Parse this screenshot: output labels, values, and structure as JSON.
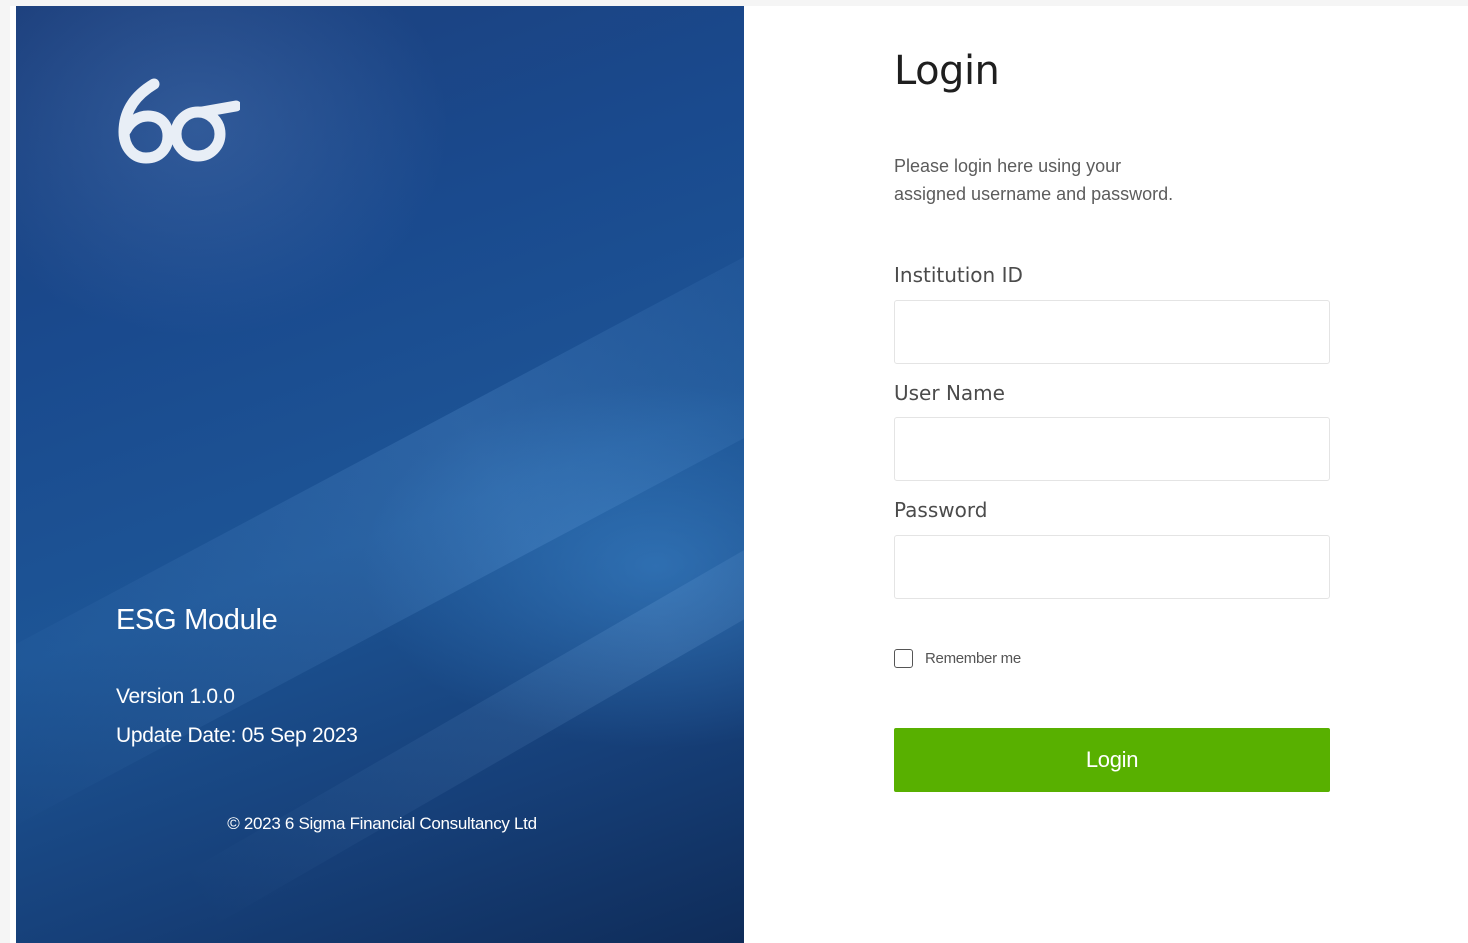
{
  "brand": {
    "logo_icon": "six-sigma-logo-icon",
    "module_title": "ESG Module",
    "version": "Version 1.0.0",
    "update_date": "Update Date: 05 Sep 2023",
    "copyright": "© 2023 6 Sigma Financial Consultancy Ltd"
  },
  "login": {
    "heading": "Login",
    "intro_line1": "Please login here using your",
    "intro_line2": "assigned username and password.",
    "fields": {
      "institution_id": {
        "label": "Institution ID",
        "value": ""
      },
      "user_name": {
        "label": "User Name",
        "value": ""
      },
      "password": {
        "label": "Password",
        "value": ""
      }
    },
    "remember_me": {
      "label": "Remember me",
      "checked": false
    },
    "submit_label": "Login"
  },
  "colors": {
    "panel_blue": "#1a4a8e",
    "button_green": "#58b000",
    "text_dark": "#1f1f1f",
    "text_muted": "#5c5c5c"
  }
}
